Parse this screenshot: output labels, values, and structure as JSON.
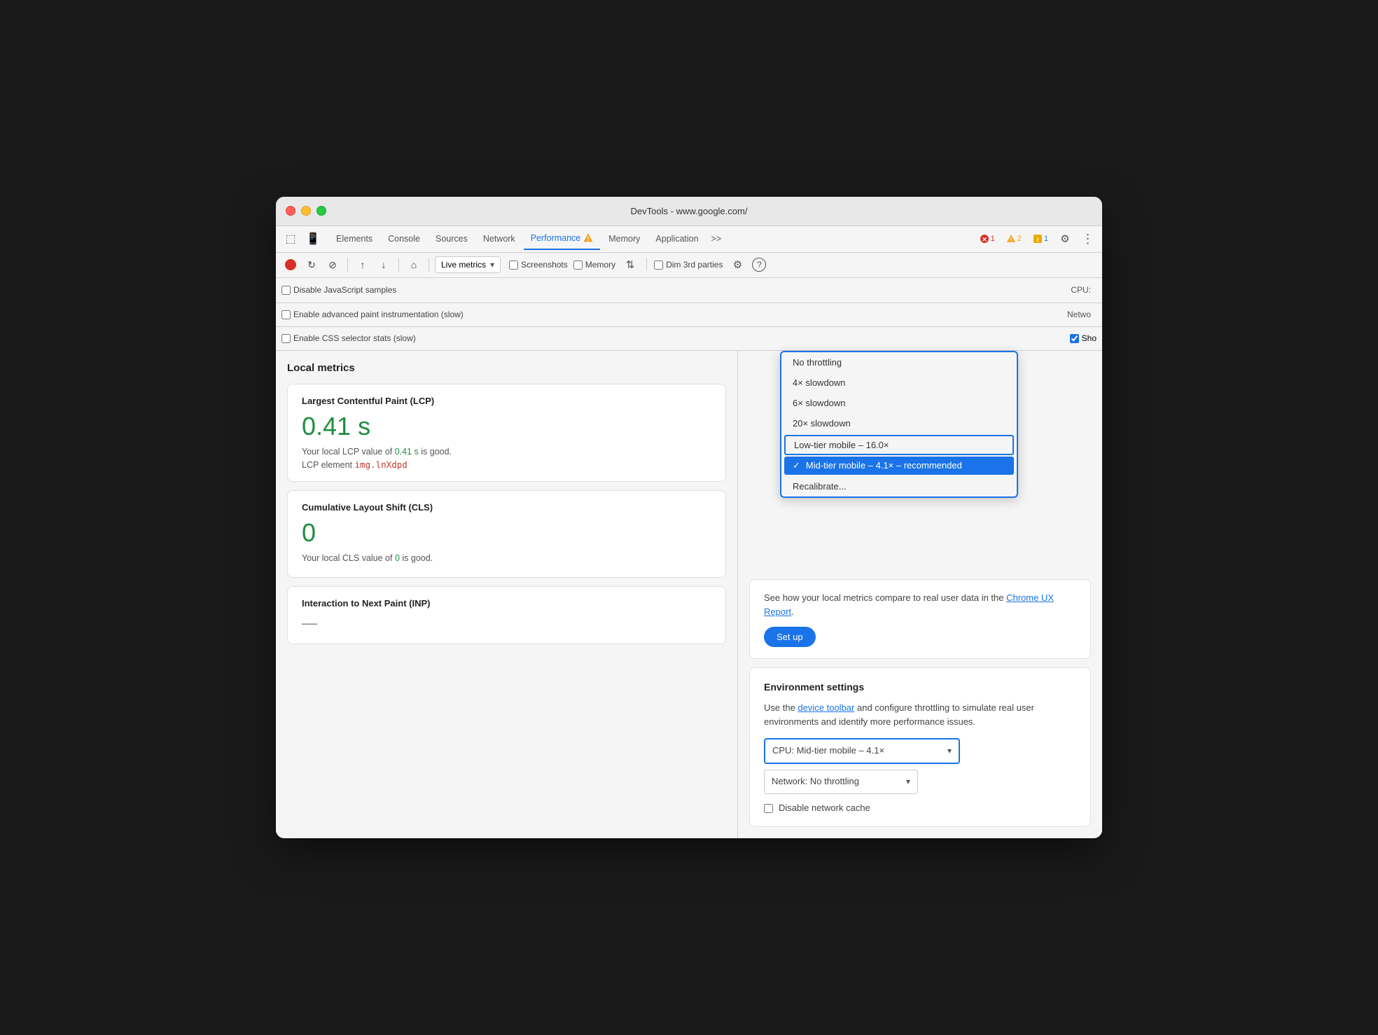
{
  "window": {
    "title": "DevTools - www.google.com/"
  },
  "tabs": [
    {
      "id": "elements",
      "label": "Elements",
      "active": false
    },
    {
      "id": "console",
      "label": "Console",
      "active": false
    },
    {
      "id": "sources",
      "label": "Sources",
      "active": false
    },
    {
      "id": "network",
      "label": "Network",
      "active": false
    },
    {
      "id": "performance",
      "label": "Performance",
      "active": true,
      "warning": true
    },
    {
      "id": "memory",
      "label": "Memory",
      "active": false
    },
    {
      "id": "application",
      "label": "Application",
      "active": false
    },
    {
      "id": "more",
      "label": ">>",
      "active": false
    }
  ],
  "badges": {
    "error": "1",
    "warning": "2",
    "info": "1"
  },
  "toolbar": {
    "live_metrics": "Live metrics",
    "screenshots_label": "Screenshots",
    "memory_label": "Memory",
    "dim_3rd_label": "Dim 3rd parties"
  },
  "options": {
    "disable_js": "Disable JavaScript samples",
    "enable_paint": "Enable advanced paint instrumentation (slow)",
    "enable_css": "Enable CSS selector stats (slow)",
    "cpu_label": "CPU:",
    "network_label": "Netwo",
    "show_label": "Sho"
  },
  "local_metrics": {
    "title": "Local metrics",
    "lcp": {
      "title": "Largest Contentful Paint (LCP)",
      "value": "0.41 s",
      "desc_pre": "Your local LCP value of ",
      "desc_val": "0.41 s",
      "desc_post": " is good.",
      "element_pre": "LCP element",
      "element_name": "img.lnXdpd"
    },
    "cls": {
      "title": "Cumulative Layout Shift (CLS)",
      "value": "0",
      "desc_pre": "Your local CLS value of ",
      "desc_val": "0",
      "desc_post": " is good."
    },
    "inp": {
      "title": "Interaction to Next Paint (INP)",
      "value": "—"
    }
  },
  "ux_report": {
    "desc": "See how your local metrics compare to real user data in the ",
    "link": "Chrome UX Report",
    "desc_end": ".",
    "setup_btn": "Set up"
  },
  "environment": {
    "title": "Environment settings",
    "desc_pre": "Use the ",
    "link": "device toolbar",
    "desc_mid": " and configure throttling to simulate real user environments and identify more performance issues.",
    "cpu_label": "CPU: Mid-tier mobile – 4.1×",
    "network_label": "Network: No throttling",
    "disable_cache": "Disable network cache"
  },
  "cpu_dropdown": {
    "items": [
      {
        "id": "no-throttle",
        "label": "No throttling",
        "selected": false
      },
      {
        "id": "4x",
        "label": "4× slowdown",
        "selected": false
      },
      {
        "id": "6x",
        "label": "6× slowdown",
        "selected": false
      },
      {
        "id": "20x",
        "label": "20× slowdown",
        "selected": false
      },
      {
        "id": "low-tier",
        "label": "Low-tier mobile – 16.0×",
        "selected": false
      },
      {
        "id": "mid-tier",
        "label": "Mid-tier mobile – 4.1× – recommended",
        "selected": true
      },
      {
        "id": "recalibrate",
        "label": "Recalibrate...",
        "selected": false
      }
    ]
  }
}
